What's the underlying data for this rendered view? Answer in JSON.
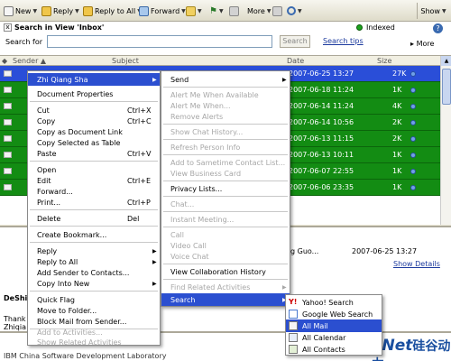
{
  "toolbar": {
    "new": "New",
    "reply": "Reply",
    "reply_all": "Reply to All",
    "forward": "Forward",
    "more": "More",
    "show": "Show"
  },
  "search": {
    "title": "Search in View 'Inbox'",
    "indexed": "Indexed",
    "label": "Search for",
    "button": "Search",
    "tips": "Search tips",
    "more": "More",
    "help": "?"
  },
  "columns": {
    "sender": "Sender",
    "subject": "Subject",
    "date": "Date",
    "size": "Size"
  },
  "rows": [
    {
      "date": "2007-06-25 13:27",
      "size": "27K"
    },
    {
      "date": "2007-06-18 11:24",
      "size": "1K"
    },
    {
      "date": "2007-06-14 11:24",
      "size": "4K"
    },
    {
      "date": "2007-06-14 10:56",
      "size": "2K"
    },
    {
      "date": "2007-06-13 11:15",
      "size": "2K"
    },
    {
      "date": "2007-06-13 10:11",
      "size": "1K"
    },
    {
      "date": "2007-06-07 22:55",
      "size": "1K"
    },
    {
      "date": "2007-06-06 23:35",
      "size": "1K"
    }
  ],
  "menu_main": {
    "header": "Zhi Qiang Sha",
    "items": [
      {
        "label": "Document Properties",
        "shortcut": ""
      },
      {
        "label": "Cut",
        "shortcut": "Ctrl+X"
      },
      {
        "label": "Copy",
        "shortcut": "Ctrl+C"
      },
      {
        "label": "Copy as Document Link",
        "shortcut": ""
      },
      {
        "label": "Copy Selected as Table",
        "shortcut": ""
      },
      {
        "label": "Paste",
        "shortcut": "Ctrl+V"
      },
      {
        "label": "Open",
        "shortcut": ""
      },
      {
        "label": "Edit",
        "shortcut": "Ctrl+E"
      },
      {
        "label": "Forward...",
        "shortcut": ""
      },
      {
        "label": "Print...",
        "shortcut": "Ctrl+P"
      },
      {
        "label": "Delete",
        "shortcut": "Del"
      },
      {
        "label": "Create Bookmark...",
        "shortcut": ""
      },
      {
        "label": "Reply",
        "shortcut": ""
      },
      {
        "label": "Reply to All",
        "shortcut": ""
      },
      {
        "label": "Add Sender to Contacts...",
        "shortcut": ""
      },
      {
        "label": "Copy Into New",
        "shortcut": ""
      },
      {
        "label": "Quick Flag",
        "shortcut": ""
      },
      {
        "label": "Move to Folder...",
        "shortcut": ""
      },
      {
        "label": "Block Mail from Sender...",
        "shortcut": ""
      },
      {
        "label": "Add to Activities...",
        "shortcut": ""
      },
      {
        "label": "Show Related Activities",
        "shortcut": ""
      }
    ]
  },
  "menu_person": {
    "items": [
      "Send",
      "Alert Me When Available",
      "Alert Me When...",
      "Remove Alerts",
      "Show Chat History...",
      "Refresh Person Info",
      "Add to Sametime Contact List...",
      "View Business Card",
      "Privacy Lists...",
      "Chat...",
      "Instant Meeting...",
      "Call",
      "Video Call",
      "Voice Chat",
      "View Collaboration History",
      "Find Related Activities",
      "Search"
    ]
  },
  "menu_search": {
    "items": [
      "Yahoo! Search",
      "Google Web Search",
      "All Mail",
      "All Calendar",
      "All Contacts"
    ]
  },
  "preview": {
    "from": "g Guo...",
    "date": "2007-06-25 13:27",
    "show_details": "Show Details",
    "recipients": "DeShi",
    "line1": "Thank",
    "line2": "Zhiqia",
    "line3": "IBM China Software Development Laboratory"
  },
  "logo": {
    "text": "eNet",
    "cn": "硅谷动力"
  }
}
